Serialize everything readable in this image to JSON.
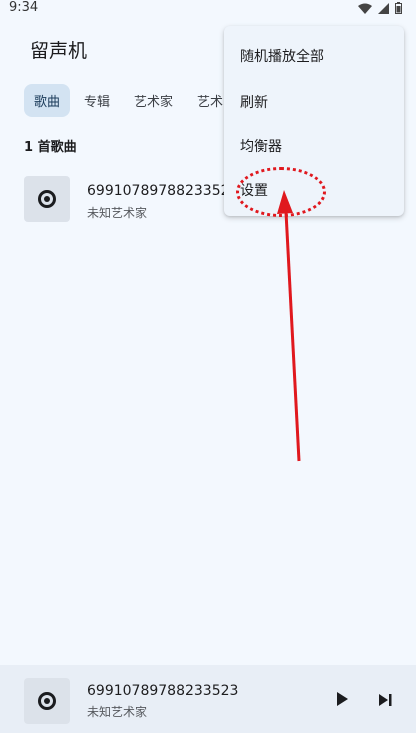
{
  "status_bar": {
    "time": "9:34",
    "icons": [
      "wifi-icon",
      "signal-icon",
      "battery-icon"
    ]
  },
  "header": {
    "title": "留声机"
  },
  "tabs": [
    {
      "label": "歌曲",
      "active": true
    },
    {
      "label": "专辑",
      "active": false
    },
    {
      "label": "艺术家",
      "active": false
    },
    {
      "label": "艺术",
      "active": false
    }
  ],
  "song_list": {
    "count_label": "1 首歌曲",
    "songs": [
      {
        "title": "69910789788233523",
        "artist": "未知艺术家",
        "icon": "disc-icon"
      }
    ]
  },
  "overflow_menu": {
    "items": [
      {
        "label": "随机播放全部"
      },
      {
        "label": "刷新"
      },
      {
        "label": "均衡器"
      },
      {
        "label": "设置"
      }
    ]
  },
  "annotation": {
    "color": "#e0181e",
    "target": "设置"
  },
  "now_playing": {
    "title": "69910789788233523",
    "artist": "未知艺术家",
    "icons": [
      "disc-icon",
      "play-icon",
      "skip-next-icon"
    ]
  },
  "colors": {
    "background": "#f3f8fe",
    "active_tab": "#d3e3f2",
    "menu_bg": "#eef4fb",
    "player_bg": "#e8eef6"
  }
}
